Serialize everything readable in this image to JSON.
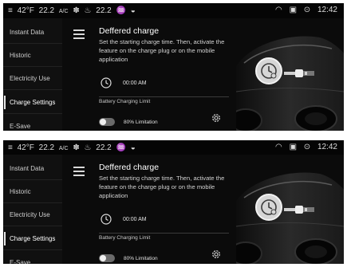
{
  "panels": [
    {
      "status": {
        "temp_outside": "42°F",
        "temp_set": "22.2",
        "ac": "A/C",
        "temp_right": "22.2",
        "clock": "12:42"
      },
      "sidebar": [
        {
          "label": "Instant Data"
        },
        {
          "label": "Historic"
        },
        {
          "label": "Electricity Use"
        },
        {
          "label": "Charge Settings"
        },
        {
          "label": "E-Save"
        }
      ],
      "main": {
        "title": "Deffered charge",
        "description": "Set the starting charge time. Then, activate the feature on the charge plug or on the mobile application",
        "time": "00:00 AM",
        "limit_label": "Battery Charging Limit",
        "limit_value": "80% Limitation"
      }
    },
    {
      "status": {
        "temp_outside": "42°F",
        "temp_set": "22.2",
        "ac": "A/C",
        "temp_right": "22.2",
        "clock": "12:42"
      },
      "sidebar": [
        {
          "label": "Instant Data"
        },
        {
          "label": "Historic"
        },
        {
          "label": "Electricity Use"
        },
        {
          "label": "Charge Settings"
        },
        {
          "label": "E-Save"
        }
      ],
      "main": {
        "title": "Deffered charge",
        "description": "Set the starting charge time. Then, activate the feature on the charge plug or on the mobile application",
        "time": "00:00 AM",
        "limit_label": "Battery Charging Limit",
        "limit_value": "80% Limitation"
      }
    }
  ],
  "icons": [
    "menu-icon",
    "clock-icon",
    "gear-icon",
    "charge-timer-icon",
    "wifi-icon",
    "car-status-icon",
    "fan-icon",
    "seat-heat-icon"
  ],
  "colors": {
    "background": "#0b0b0b",
    "text": "#e8e8e8",
    "accent": "#d6d6d6"
  }
}
